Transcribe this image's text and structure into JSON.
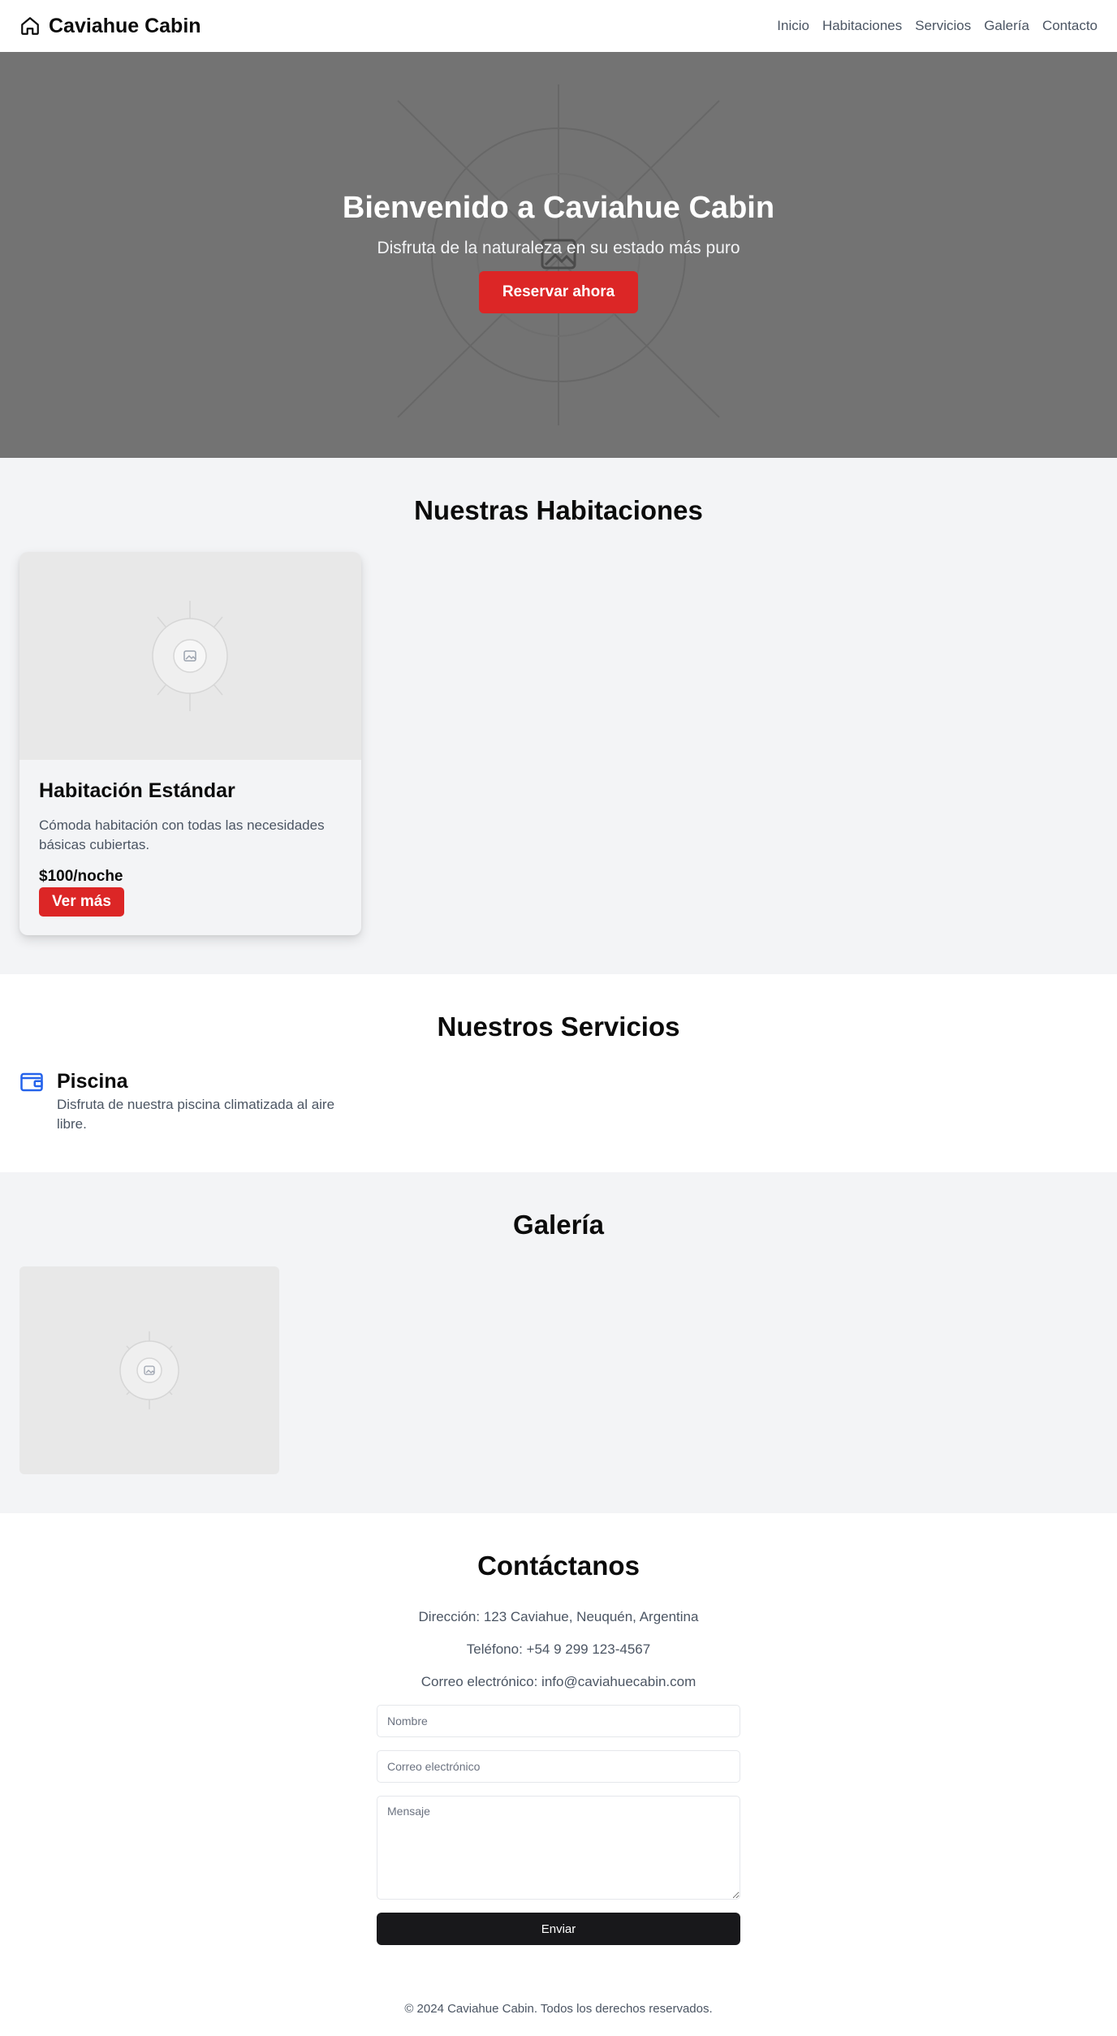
{
  "header": {
    "brand": "Caviahue Cabin",
    "brand_icon": "home-icon",
    "nav": [
      "Inicio",
      "Habitaciones",
      "Servicios",
      "Galería",
      "Contacto"
    ]
  },
  "hero": {
    "title": "Bienvenido a Caviahue Cabin",
    "subtitle": "Disfruta de la naturaleza en su estado más puro",
    "cta": "Reservar ahora",
    "image_icon": "image-placeholder-icon"
  },
  "rooms": {
    "title": "Nuestras Habitaciones",
    "items": [
      {
        "name": "Habitación Estándar",
        "description": "Cómoda habitación con todas las necesidades básicas cubiertas.",
        "price": "$100/noche",
        "button": "Ver más"
      }
    ]
  },
  "services": {
    "title": "Nuestros Servicios",
    "items": [
      {
        "icon": "wallet-icon",
        "name": "Piscina",
        "description": "Disfruta de nuestra piscina climatizada al aire libre."
      }
    ]
  },
  "gallery": {
    "title": "Galería"
  },
  "contact": {
    "title": "Contáctanos",
    "address": "Dirección: 123 Caviahue, Neuquén, Argentina",
    "phone": "Teléfono: +54 9 299 123-4567",
    "email": "Correo electrónico: info@caviahuecabin.com",
    "form": {
      "name_placeholder": "Nombre",
      "email_placeholder": "Correo electrónico",
      "message_placeholder": "Mensaje",
      "submit": "Enviar"
    }
  },
  "footer": {
    "text": "© 2024 Caviahue Cabin. Todos los derechos reservados."
  },
  "colors": {
    "accent": "#dc2626",
    "hero_bg": "#737373",
    "section_gray": "#f3f4f6",
    "icon_blue": "#2563eb",
    "submit_bg": "#18181b"
  }
}
